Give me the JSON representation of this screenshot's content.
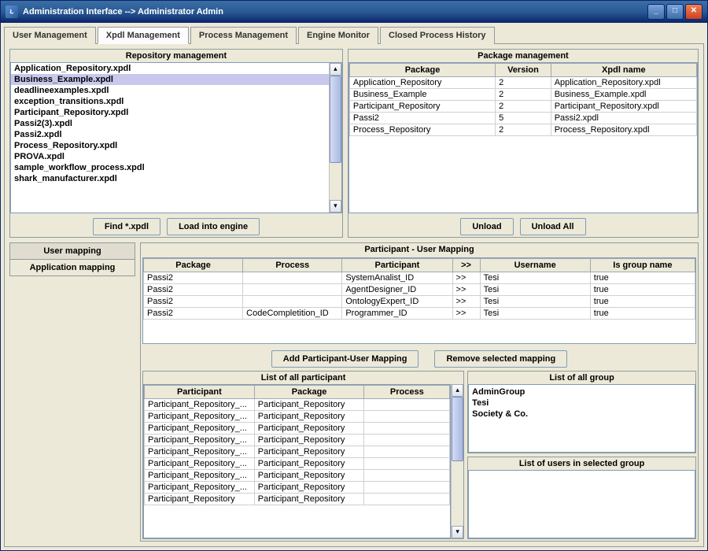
{
  "window": {
    "title": "Administration Interface --> Administrator Admin"
  },
  "tabs": {
    "items": [
      "User Management",
      "Xpdl Management",
      "Process Management",
      "Engine Monitor",
      "Closed Process History"
    ],
    "active": 1
  },
  "repository": {
    "header": "Repository management",
    "items": [
      "Application_Repository.xpdl",
      "Business_Example.xpdl",
      "deadlineexamples.xpdl",
      "exception_transitions.xpdl",
      "Participant_Repository.xpdl",
      "Passi2(3).xpdl",
      "Passi2.xpdl",
      "Process_Repository.xpdl",
      "PROVA.xpdl",
      "sample_workflow_process.xpdl",
      "shark_manufacturer.xpdl"
    ],
    "selected": 1,
    "buttons": {
      "find": "Find *.xpdl",
      "load": "Load into engine"
    }
  },
  "packages": {
    "header": "Package management",
    "cols": [
      "Package",
      "Version",
      "Xpdl name"
    ],
    "rows": [
      [
        "Application_Repository",
        "2",
        "Application_Repository.xpdl"
      ],
      [
        "Business_Example",
        "2",
        "Business_Example.xpdl"
      ],
      [
        "Participant_Repository",
        "2",
        "Participant_Repository.xpdl"
      ],
      [
        "Passi2",
        "5",
        "Passi2.xpdl"
      ],
      [
        "Process_Repository",
        "2",
        "Process_Repository.xpdl"
      ]
    ],
    "buttons": {
      "unload": "Unload",
      "unloadAll": "Unload All"
    }
  },
  "mapping": {
    "sideTabs": [
      "User mapping",
      "Application mapping"
    ],
    "header": "Participant - User Mapping",
    "cols": [
      "Package",
      "Process",
      "Participant",
      ">>",
      "Username",
      "Is group name"
    ],
    "rows": [
      [
        "Passi2",
        "",
        "SystemAnalist_ID",
        ">>",
        "Tesi",
        "true"
      ],
      [
        "Passi2",
        "",
        "AgentDesigner_ID",
        ">>",
        "Tesi",
        "true"
      ],
      [
        "Passi2",
        "",
        "OntologyExpert_ID",
        ">>",
        "Tesi",
        "true"
      ],
      [
        "Passi2",
        "CodeCompletition_ID",
        "Programmer_ID",
        ">>",
        "Tesi",
        "true"
      ]
    ],
    "buttons": {
      "add": "Add Participant-User Mapping",
      "remove": "Remove selected mapping"
    }
  },
  "participants": {
    "header": "List of all participant",
    "cols": [
      "Participant",
      "Package",
      "Process"
    ],
    "rows": [
      [
        "Participant_Repository_...",
        "Participant_Repository",
        ""
      ],
      [
        "Participant_Repository_...",
        "Participant_Repository",
        ""
      ],
      [
        "Participant_Repository_...",
        "Participant_Repository",
        ""
      ],
      [
        "Participant_Repository_...",
        "Participant_Repository",
        ""
      ],
      [
        "Participant_Repository_...",
        "Participant_Repository",
        ""
      ],
      [
        "Participant_Repository_...",
        "Participant_Repository",
        ""
      ],
      [
        "Participant_Repository_...",
        "Participant_Repository",
        ""
      ],
      [
        "Participant_Repository_...",
        "Participant_Repository",
        ""
      ],
      [
        "Participant_Repository",
        "Participant_Repository",
        ""
      ]
    ]
  },
  "groups": {
    "header": "List of all group",
    "items": [
      "AdminGroup",
      "Tesi",
      "Society & Co."
    ],
    "usersHeader": "List of users in selected group"
  }
}
